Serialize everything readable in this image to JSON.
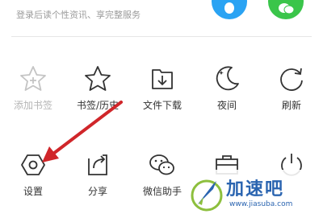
{
  "header": {
    "login_tip": "登录后读个性资讯、享完整服务",
    "qq_icon": "qq-penguin-icon",
    "wechat_icon": "wechat-icon"
  },
  "menu": {
    "row1": [
      {
        "label": "添加书签",
        "icon": "star-plus-icon",
        "enabled": false
      },
      {
        "label": "书签/历史",
        "icon": "star-icon",
        "enabled": true
      },
      {
        "label": "文件下载",
        "icon": "download-icon",
        "enabled": true
      },
      {
        "label": "夜间",
        "icon": "moon-icon",
        "enabled": true
      },
      {
        "label": "刷新",
        "icon": "refresh-icon",
        "enabled": true
      }
    ],
    "row2": [
      {
        "label": "设置",
        "icon": "settings-hexagon-icon",
        "enabled": true
      },
      {
        "label": "分享",
        "icon": "share-icon",
        "enabled": true
      },
      {
        "label": "微信助手",
        "icon": "wechat-assistant-icon",
        "enabled": true
      },
      {
        "label": "",
        "icon": "toolbox-icon",
        "enabled": true
      },
      {
        "label": "",
        "icon": "power-icon",
        "enabled": true
      }
    ]
  },
  "watermark": {
    "brand": "加速吧",
    "url": "www.jiasuba.com"
  },
  "colors": {
    "qq": "#2aa3f3",
    "wechat": "#3ac54a",
    "arrow": "#d0262a",
    "watermark": "#2a64b0"
  }
}
